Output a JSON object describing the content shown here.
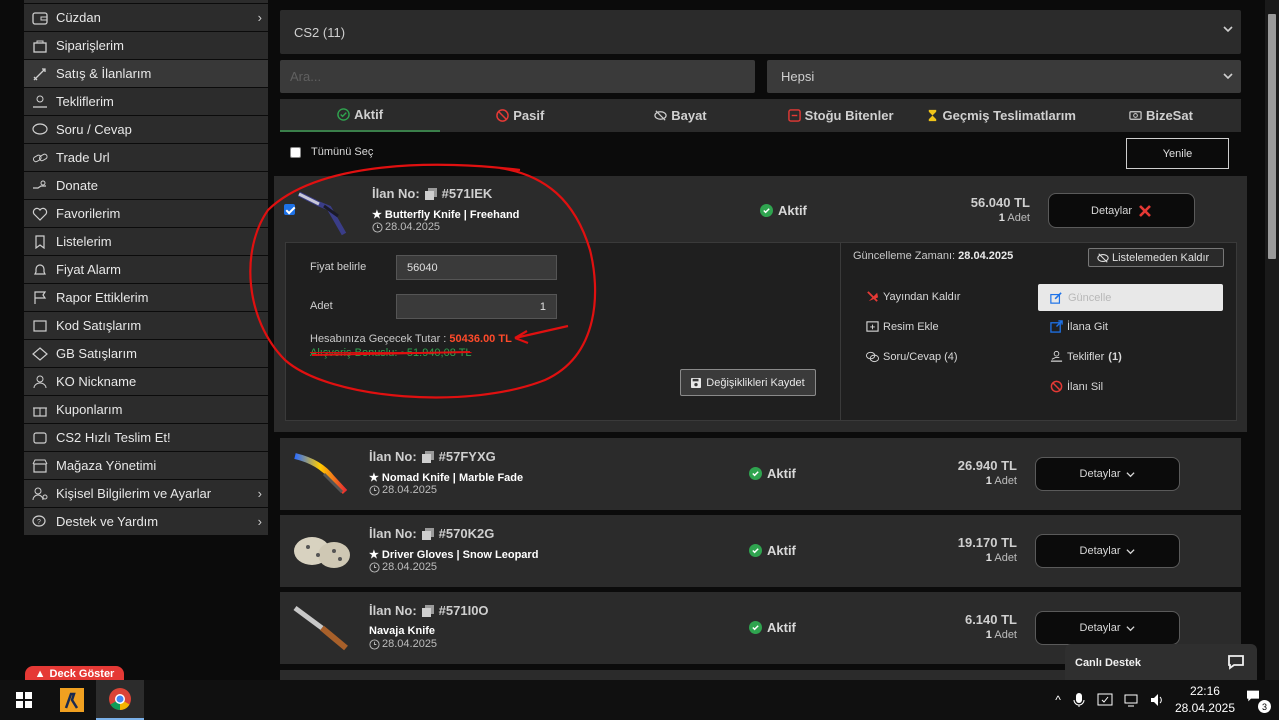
{
  "sidebar": {
    "items": [
      {
        "label": "Cüzdan",
        "icon": "wallet-icon",
        "chevron": "›"
      },
      {
        "label": "Siparişlerim",
        "icon": "shopping-bag-icon"
      },
      {
        "label": "Satış & İlanlarım",
        "icon": "sword-icon"
      },
      {
        "label": "Tekliflerim",
        "icon": "hand-coins-icon"
      },
      {
        "label": "Soru / Cevap",
        "icon": "comment-icon"
      },
      {
        "label": "Trade Url",
        "icon": "link-icon"
      },
      {
        "label": "Donate",
        "icon": "heart-hand-icon"
      },
      {
        "label": "Favorilerim",
        "icon": "heart-icon"
      },
      {
        "label": "Listelerim",
        "icon": "bookmark-icon"
      },
      {
        "label": "Fiyat Alarm",
        "icon": "bell-icon"
      },
      {
        "label": "Rapor Ettiklerim",
        "icon": "flag-icon"
      },
      {
        "label": "Kod Satışlarım",
        "icon": "key-icon"
      },
      {
        "label": "GB Satışlarım",
        "icon": "tag-icon"
      },
      {
        "label": "KO Nickname",
        "icon": "user-icon"
      },
      {
        "label": "Kuponlarım",
        "icon": "gift-icon"
      },
      {
        "label": "CS2 Hızlı Teslim Et!",
        "icon": "lightning-icon"
      },
      {
        "label": "Mağaza Yönetimi",
        "icon": "store-icon"
      },
      {
        "label": "Kişisel Bilgilerim ve Ayarlar",
        "icon": "user-gear-icon",
        "chevron": "›"
      },
      {
        "label": "Destek ve Yardım",
        "icon": "support-icon",
        "chevron": "›"
      }
    ]
  },
  "filters": {
    "game_select": "CS2 (11)",
    "search_placeholder": "Ara...",
    "type_select": "Hepsi"
  },
  "tabs": [
    {
      "label": "Aktif",
      "icon": "check-circle-icon",
      "color": "#2fa44f"
    },
    {
      "label": "Pasif",
      "icon": "ban-icon",
      "color": "#e53935"
    },
    {
      "label": "Bayat",
      "icon": "eye-slash-icon",
      "color": "#cfcfcf"
    },
    {
      "label": "Stoğu Bitenler",
      "icon": "minus-square-icon",
      "color": "#e53935"
    },
    {
      "label": "Geçmiş Teslimatlarım",
      "icon": "hourglass-icon",
      "color": "#f0c419"
    },
    {
      "label": "BizeSat",
      "icon": "money-icon",
      "color": "#cfcfcf"
    }
  ],
  "select_all_label": "Tümünü Seç",
  "refresh_label": "Yenile",
  "listing_no_prefix": "İlan No:",
  "listings": [
    {
      "id": "#571IEK",
      "name": "★ Butterfly Knife | Freehand",
      "date": "28.04.2025",
      "status": "Aktif",
      "price": "56.040 TL",
      "qty": "1",
      "qty_unit": "Adet",
      "details": "Detaylar"
    },
    {
      "id": "#57FYXG",
      "name": "★ Nomad Knife | Marble Fade",
      "date": "28.04.2025",
      "status": "Aktif",
      "price": "26.940 TL",
      "qty": "1",
      "qty_unit": "Adet",
      "details": "Detaylar"
    },
    {
      "id": "#570K2G",
      "name": "★ Driver Gloves | Snow Leopard",
      "date": "28.04.2025",
      "status": "Aktif",
      "price": "19.170 TL",
      "qty": "1",
      "qty_unit": "Adet",
      "details": "Detaylar"
    },
    {
      "id": "#571I0O",
      "name": "Navaja Knife",
      "date": "28.04.2025",
      "status": "Aktif",
      "price": "6.140 TL",
      "qty": "1",
      "qty_unit": "Adet",
      "details": "Detaylar"
    }
  ],
  "edit": {
    "price_label": "Fiyat belirle",
    "price_value": "56040",
    "qty_label": "Adet",
    "qty_value": "1",
    "payout_label": "Hesabınıza Geçecek Tutar :",
    "payout_amount": "50436.00 TL",
    "bonus_text": "Alışveriş Bonuslu: ~51.940,08 TL",
    "save_label": "Değişiklikleri Kaydet"
  },
  "info": {
    "update_time_label": "Güncelleme Zamanı:",
    "update_time_value": "28.04.2025",
    "unlist_label": "Listelemeden Kaldır",
    "update_label": "Güncelle",
    "actions": {
      "unpublish": "Yayından Kaldır",
      "add_image": "Resim Ekle",
      "goto": "İlana Git",
      "qa": "Soru/Cevap (4)",
      "offers": "Teklifler",
      "offers_count": "(1)",
      "delete": "İlanı Sil"
    }
  },
  "deck_button": "Deck Göster",
  "live_support": "Canlı Destek",
  "taskbar": {
    "time": "22:16",
    "date": "28.04.2025",
    "notifications": "3"
  }
}
